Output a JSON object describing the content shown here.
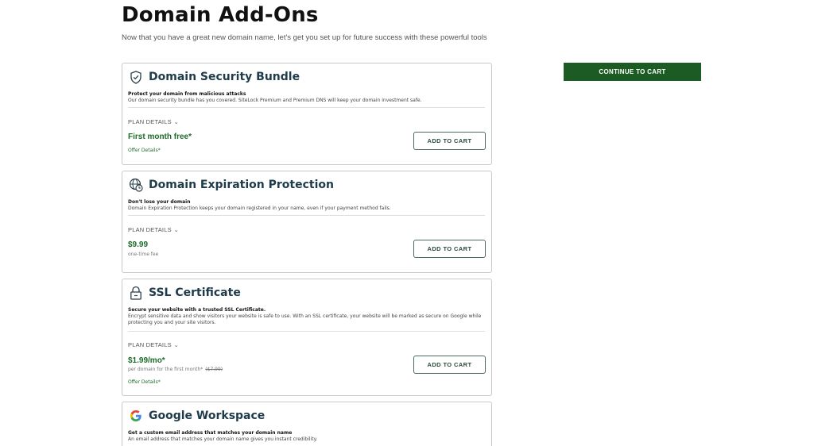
{
  "page": {
    "title": "Domain Add-Ons",
    "subtitle": "Now that you have a great new domain name, let's get you set up for future success with these powerful tools"
  },
  "actions": {
    "continue_label": "CONTINUE TO CART"
  },
  "colors": {
    "brand_green": "#1c5c24",
    "price_green": "#1c6b2b",
    "title_navy": "#1e3b4a"
  },
  "cards": [
    {
      "icon": "shield-check-icon",
      "title": "Domain Security Bundle",
      "tagline": "Protect your domain from malicious attacks",
      "description": "Our domain security bundle has you covered. SiteLock Premium and Premium DNS will keep your domain investment safe.",
      "plan_details": "PLAN DETAILS",
      "price": "First month free*",
      "offer_link": "Offer Details*",
      "add_label": "ADD TO CART"
    },
    {
      "icon": "globe-clock-icon",
      "title": "Domain Expiration Protection",
      "tagline": "Don't lose your domain",
      "description": "Domain Expiration Protection keeps your domain registered in your name, even if your payment method fails.",
      "plan_details": "PLAN DETAILS",
      "price": "$9.99",
      "price_note": "one-time fee",
      "add_label": "ADD TO CART"
    },
    {
      "icon": "lock-icon",
      "title": "SSL Certificate",
      "tagline": "Secure your website with a trusted SSL Certificate.",
      "description": "Encrypt sensitive data and show visitors your website is safe to use. With an SSL certificate, your website will be marked as secure on Google while protecting you and your site visitors.",
      "plan_details": "PLAN DETAILS",
      "price": "$1.99/mo*",
      "price_note": "per domain for the first month*",
      "price_strike": "($7.99)",
      "offer_link": "Offer Details*",
      "add_label": "ADD TO CART"
    },
    {
      "icon": "google-logo-icon",
      "title": "Google Workspace",
      "tagline": "Get a custom email address that matches your domain name",
      "description": "An email address that matches your domain name gives you instant credibility."
    }
  ]
}
